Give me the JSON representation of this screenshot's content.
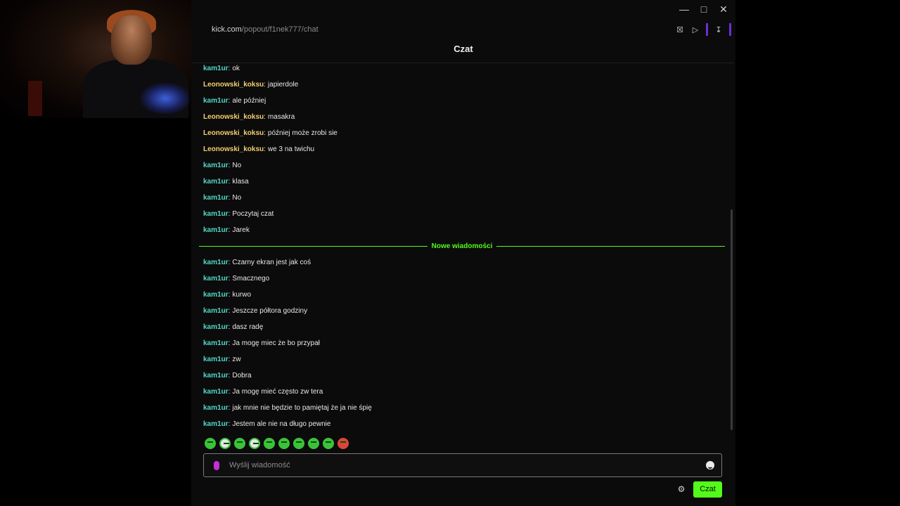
{
  "window": {
    "url_host": "kick.com",
    "url_path": "/popout/f1nek777/chat",
    "title": "Czat"
  },
  "icons": {
    "minimize": "minimize-icon",
    "maximize": "maximize-icon",
    "close": "close-icon",
    "shield": "shield-x-icon",
    "play": "play-icon",
    "download": "download-icon",
    "mic": "mic-icon",
    "emoji": "emoji-icon",
    "settings": "gear-icon"
  },
  "messages_before": [
    {
      "user": "kam1ur",
      "type": "kam",
      "text": "ok"
    },
    {
      "user": "Leonowski_koksu",
      "type": "leo",
      "text": "japierdole"
    },
    {
      "user": "kam1ur",
      "type": "kam",
      "text": "ale później"
    },
    {
      "user": "Leonowski_koksu",
      "type": "leo",
      "text": "masakra"
    },
    {
      "user": "Leonowski_koksu",
      "type": "leo",
      "text": "później może zrobi sie"
    },
    {
      "user": "Leonowski_koksu",
      "type": "leo",
      "text": "we 3 na twichu"
    },
    {
      "user": "kam1ur",
      "type": "kam",
      "text": "No"
    },
    {
      "user": "kam1ur",
      "type": "kam",
      "text": "klasa"
    },
    {
      "user": "kam1ur",
      "type": "kam",
      "text": "No"
    },
    {
      "user": "kam1ur",
      "type": "kam",
      "text": "Poczytaj czat"
    },
    {
      "user": "kam1ur",
      "type": "kam",
      "text": "Jarek"
    }
  ],
  "new_messages_label": "Nowe wiadomości",
  "messages_after": [
    {
      "user": "kam1ur",
      "type": "kam",
      "text": "Czarny ekran jest jak coś"
    },
    {
      "user": "kam1ur",
      "type": "kam",
      "text": "Smacznego"
    },
    {
      "user": "kam1ur",
      "type": "kam",
      "text": "kurwo"
    },
    {
      "user": "kam1ur",
      "type": "kam",
      "text": "Jeszcze półtora godziny"
    },
    {
      "user": "kam1ur",
      "type": "kam",
      "text": "dasz radę"
    },
    {
      "user": "kam1ur",
      "type": "kam",
      "text": "Ja mogę miec że bo przypał"
    },
    {
      "user": "kam1ur",
      "type": "kam",
      "text": "zw"
    },
    {
      "user": "kam1ur",
      "type": "kam",
      "text": "Dobra"
    },
    {
      "user": "kam1ur",
      "type": "kam",
      "text": "Ja mogę mieć często zw tera"
    },
    {
      "user": "kam1ur",
      "type": "kam",
      "text": "jak mnie nie będzie to pamiętaj że ja nie śpię"
    },
    {
      "user": "kam1ur",
      "type": "kam",
      "text": "Jestem ale nie na długo pewnie"
    }
  ],
  "emotes": [
    "green",
    "white",
    "green",
    "white",
    "green",
    "green",
    "green",
    "green",
    "green",
    "red"
  ],
  "input": {
    "placeholder": "Wyślij wiadomość",
    "value": ""
  },
  "send_label": "Czat",
  "colors": {
    "accent": "#53fc18",
    "user_kam": "#52d8c5",
    "user_leo": "#f2cf6e",
    "background": "#0b0b0c"
  }
}
